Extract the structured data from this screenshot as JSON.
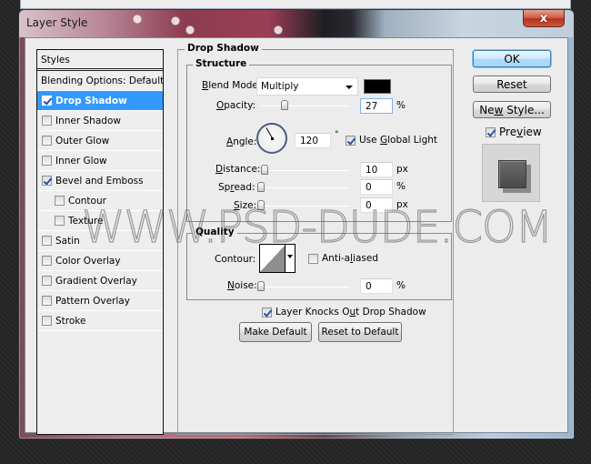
{
  "window": {
    "title": "Layer Style",
    "close_label": "x"
  },
  "styles_panel": {
    "header": "Styles",
    "blending_options": "Blending Options: Default",
    "items": [
      {
        "label": "Drop Shadow",
        "checked": true,
        "selected": true,
        "sub": false
      },
      {
        "label": "Inner Shadow",
        "checked": false,
        "selected": false,
        "sub": false
      },
      {
        "label": "Outer Glow",
        "checked": false,
        "selected": false,
        "sub": false
      },
      {
        "label": "Inner Glow",
        "checked": false,
        "selected": false,
        "sub": false
      },
      {
        "label": "Bevel and Emboss",
        "checked": true,
        "selected": false,
        "sub": false
      },
      {
        "label": "Contour",
        "checked": false,
        "selected": false,
        "sub": true
      },
      {
        "label": "Texture",
        "checked": false,
        "selected": false,
        "sub": true
      },
      {
        "label": "Satin",
        "checked": false,
        "selected": false,
        "sub": false
      },
      {
        "label": "Color Overlay",
        "checked": false,
        "selected": false,
        "sub": false
      },
      {
        "label": "Gradient Overlay",
        "checked": false,
        "selected": false,
        "sub": false
      },
      {
        "label": "Pattern Overlay",
        "checked": false,
        "selected": false,
        "sub": false
      },
      {
        "label": "Stroke",
        "checked": false,
        "selected": false,
        "sub": false
      }
    ]
  },
  "drop_shadow": {
    "section_title": "Drop Shadow",
    "structure": {
      "title": "Structure",
      "blend_mode_label": "Blend Mode:",
      "blend_mode_value": "Multiply",
      "shadow_color": "#000000",
      "opacity_label": "Opacity:",
      "opacity_value": "27",
      "opacity_unit": "%",
      "opacity_fraction": 0.27,
      "angle_label": "Angle:",
      "angle_value": "120",
      "angle_unit": "°",
      "angle_degrees": 120,
      "use_global_light_label": "Use Global Light",
      "use_global_light_checked": true,
      "distance_label": "Distance:",
      "distance_value": "10",
      "distance_unit": "px",
      "distance_fraction": 0.04,
      "spread_label": "Spread:",
      "spread_value": "0",
      "spread_unit": "%",
      "spread_fraction": 0,
      "size_label": "Size:",
      "size_value": "0",
      "size_unit": "px",
      "size_fraction": 0
    },
    "quality": {
      "title": "Quality",
      "contour_label": "Contour:",
      "anti_aliased_label": "Anti-aliased",
      "anti_aliased_checked": false,
      "noise_label": "Noise:",
      "noise_value": "0",
      "noise_unit": "%",
      "noise_fraction": 0
    },
    "knockout_label": "Layer Knocks Out Drop Shadow",
    "knockout_checked": true,
    "make_default_label": "Make Default",
    "reset_to_default_label": "Reset to Default"
  },
  "side_buttons": {
    "ok_label": "OK",
    "reset_label": "Reset",
    "new_style_label": "New Style...",
    "preview_label": "Preview",
    "preview_checked": true
  },
  "watermark": "WWW.PSD-DUDE.COM"
}
